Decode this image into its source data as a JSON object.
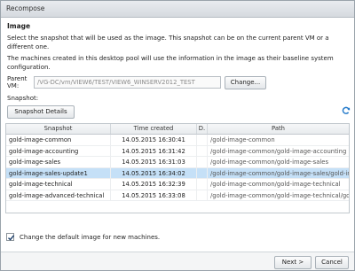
{
  "dialog": {
    "title": "Recompose"
  },
  "image_section": {
    "title": "Image",
    "para1": "Select the snapshot that will be used as the image. This snapshot can be on the current parent VM or a different one.",
    "para2": "The machines created in this desktop pool will use the information in the image as their baseline system configuration.",
    "parent_vm_label": "Parent VM:",
    "parent_vm_value": "/VG-DC/vm/VIEW6/TEST/VIEW6_WINSERV2012_TEST",
    "change_label": "Change...",
    "snapshot_label": "Snapshot:",
    "details_label": "Snapshot Details"
  },
  "table": {
    "columns": [
      "Snapshot",
      "Time created",
      "D.",
      "Path"
    ],
    "rows": [
      {
        "snapshot": "gold-image-common",
        "time": "14.05.2015 16:30:41",
        "d": "",
        "path": "/gold-image-common"
      },
      {
        "snapshot": "gold-image-accounting",
        "time": "14.05.2015 16:31:42",
        "d": "",
        "path": "/gold-image-common/gold-image-accounting"
      },
      {
        "snapshot": "gold-image-sales",
        "time": "14.05.2015 16:31:03",
        "d": "",
        "path": "/gold-image-common/gold-image-sales"
      },
      {
        "snapshot": "gold-image-sales-update1",
        "time": "14.05.2015 16:34:02",
        "d": "",
        "path": "/gold-image-common/gold-image-sales/gold-image-sales-update1",
        "selected": true
      },
      {
        "snapshot": "gold-image-technical",
        "time": "14.05.2015 16:32:39",
        "d": "",
        "path": "/gold-image-common/gold-image-technical"
      },
      {
        "snapshot": "gold-image-advanced-technical",
        "time": "14.05.2015 16:33:08",
        "d": "",
        "path": "/gold-image-common/gold-image-technical/gold-image-advanced-technical"
      }
    ]
  },
  "options": {
    "change_default_label": "Change the default image for new machines.",
    "change_default_checked": true
  },
  "footer": {
    "next_label": "Next >",
    "cancel_label": "Cancel"
  },
  "icons": {
    "refresh": "refresh-icon",
    "check": "check-icon"
  },
  "colors": {
    "selected_row": "#c5e0f7",
    "refresh": "#1f77c9"
  }
}
